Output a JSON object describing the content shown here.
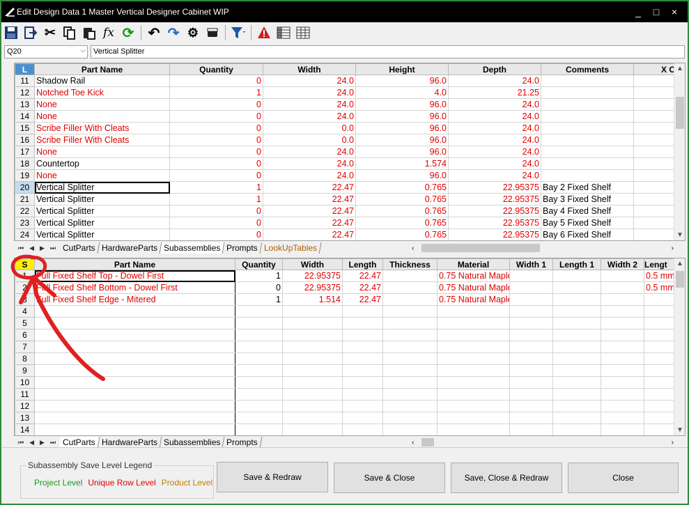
{
  "window": {
    "title": "Edit Design Data 1 Master Vertical Designer Cabinet WIP",
    "minimize": "_",
    "maximize": "□",
    "close": "×"
  },
  "formula": {
    "cell_ref": "Q20",
    "value": "Vertical Splitter"
  },
  "top_grid": {
    "corner": "L",
    "headers": [
      "Part Name",
      "Quantity",
      "Width",
      "Height",
      "Depth",
      "Comments",
      "X C"
    ],
    "rows": [
      {
        "n": "11",
        "name": "Shadow Rail",
        "qty": "0",
        "w": "24.0",
        "h": "96.0",
        "d": "24.0",
        "c": "",
        "red": false
      },
      {
        "n": "12",
        "name": "Notched Toe Kick",
        "qty": "1",
        "w": "24.0",
        "h": "4.0",
        "d": "21.25",
        "c": "",
        "red": true
      },
      {
        "n": "13",
        "name": "None",
        "qty": "0",
        "w": "24.0",
        "h": "96.0",
        "d": "24.0",
        "c": "",
        "red": true
      },
      {
        "n": "14",
        "name": "None",
        "qty": "0",
        "w": "24.0",
        "h": "96.0",
        "d": "24.0",
        "c": "",
        "red": true
      },
      {
        "n": "15",
        "name": "Scribe Filler With Cleats",
        "qty": "0",
        "w": "0.0",
        "h": "96.0",
        "d": "24.0",
        "c": "",
        "red": true
      },
      {
        "n": "16",
        "name": "Scribe Filler With Cleats",
        "qty": "0",
        "w": "0.0",
        "h": "96.0",
        "d": "24.0",
        "c": "",
        "red": true
      },
      {
        "n": "17",
        "name": "None",
        "qty": "0",
        "w": "24.0",
        "h": "96.0",
        "d": "24.0",
        "c": "",
        "red": true
      },
      {
        "n": "18",
        "name": "Countertop",
        "qty": "0",
        "w": "24.0",
        "h": "1.574",
        "d": "24.0",
        "c": "",
        "red": false
      },
      {
        "n": "19",
        "name": "None",
        "qty": "0",
        "w": "24.0",
        "h": "96.0",
        "d": "24.0",
        "c": "",
        "red": true
      },
      {
        "n": "20",
        "name": "Vertical Splitter",
        "qty": "1",
        "w": "22.47",
        "h": "0.765",
        "d": "22.95375",
        "c": "Bay 2 Fixed Shelf",
        "red": false
      },
      {
        "n": "21",
        "name": "Vertical Splitter",
        "qty": "1",
        "w": "22.47",
        "h": "0.765",
        "d": "22.95375",
        "c": "Bay 3 Fixed Shelf",
        "red": false
      },
      {
        "n": "22",
        "name": "Vertical Splitter",
        "qty": "0",
        "w": "22.47",
        "h": "0.765",
        "d": "22.95375",
        "c": "Bay 4 Fixed Shelf",
        "red": false
      },
      {
        "n": "23",
        "name": "Vertical Splitter",
        "qty": "0",
        "w": "22.47",
        "h": "0.765",
        "d": "22.95375",
        "c": "Bay 5 Fixed Shelf",
        "red": false
      },
      {
        "n": "24",
        "name": "Vertical Splitter",
        "qty": "0",
        "w": "22.47",
        "h": "0.765",
        "d": "22.95375",
        "c": "Bay 6 Fixed Shelf",
        "red": false
      }
    ],
    "tabs": [
      "CutParts",
      "HardwareParts",
      "Subassemblies",
      "Prompts",
      "LookUpTables"
    ]
  },
  "bottom_grid": {
    "corner": "S",
    "headers": [
      "Part Name",
      "Quantity",
      "Width",
      "Length",
      "Thickness",
      "Material",
      "Width 1",
      "Length 1",
      "Width 2",
      "Lengt"
    ],
    "rows": [
      {
        "n": "1",
        "name": "Full Fixed Shelf Top - Dowel First",
        "qty": "1",
        "w": "22.95375",
        "l": "22.47",
        "t": "",
        "m": "0.75 Natural Maple",
        "extra": "0.5 mm"
      },
      {
        "n": "2",
        "name": "Full Fixed Shelf Bottom - Dowel First",
        "qty": "0",
        "w": "22.95375",
        "l": "22.47",
        "t": "",
        "m": "0.75 Natural Maple",
        "extra": "0.5 mm"
      },
      {
        "n": "3",
        "name": "Full Fixed Shelf Edge - Mitered",
        "qty": "1",
        "w": "1.514",
        "l": "22.47",
        "t": "",
        "m": "0.75 Natural Maple",
        "extra": ""
      },
      {
        "n": "4",
        "name": "",
        "qty": "",
        "w": "",
        "l": "",
        "t": "",
        "m": "",
        "extra": ""
      },
      {
        "n": "5",
        "name": "",
        "qty": "",
        "w": "",
        "l": "",
        "t": "",
        "m": "",
        "extra": ""
      },
      {
        "n": "6",
        "name": "",
        "qty": "",
        "w": "",
        "l": "",
        "t": "",
        "m": "",
        "extra": ""
      },
      {
        "n": "7",
        "name": "",
        "qty": "",
        "w": "",
        "l": "",
        "t": "",
        "m": "",
        "extra": ""
      },
      {
        "n": "8",
        "name": "",
        "qty": "",
        "w": "",
        "l": "",
        "t": "",
        "m": "",
        "extra": ""
      },
      {
        "n": "9",
        "name": "",
        "qty": "",
        "w": "",
        "l": "",
        "t": "",
        "m": "",
        "extra": ""
      },
      {
        "n": "10",
        "name": "",
        "qty": "",
        "w": "",
        "l": "",
        "t": "",
        "m": "",
        "extra": ""
      },
      {
        "n": "11",
        "name": "",
        "qty": "",
        "w": "",
        "l": "",
        "t": "",
        "m": "",
        "extra": ""
      },
      {
        "n": "12",
        "name": "",
        "qty": "",
        "w": "",
        "l": "",
        "t": "",
        "m": "",
        "extra": ""
      },
      {
        "n": "13",
        "name": "",
        "qty": "",
        "w": "",
        "l": "",
        "t": "",
        "m": "",
        "extra": ""
      },
      {
        "n": "14",
        "name": "",
        "qty": "",
        "w": "",
        "l": "",
        "t": "",
        "m": "",
        "extra": ""
      }
    ],
    "tabs": [
      "CutParts",
      "HardwareParts",
      "Subassemblies",
      "Prompts"
    ]
  },
  "legend": {
    "title": "Subassembly Save Level Legend",
    "project": "Project Level",
    "unique": "Unique Row Level",
    "product": "Product Level"
  },
  "buttons": {
    "save_redraw": "Save & Redraw",
    "save_close": "Save & Close",
    "save_close_redraw": "Save, Close & Redraw",
    "close": "Close"
  },
  "colors": {
    "red_text": "#e00000",
    "green": "#1a9a1a",
    "orange": "#c08000",
    "annotation": "#e02020"
  }
}
